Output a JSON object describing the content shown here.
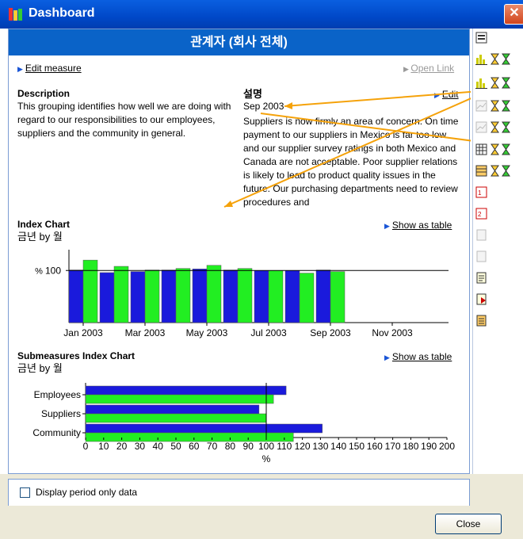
{
  "window": {
    "title": "Dashboard",
    "close_glyph": "✕"
  },
  "header": {
    "title": "관계자 (회사 전체)"
  },
  "links": {
    "edit_measure": "Edit measure",
    "open_link": "Open Link",
    "edit": "Edit",
    "show_as_table": "Show as table"
  },
  "description": {
    "label": "Description",
    "text": "This grouping identifies how well we are doing with regard to our responsibilities to our employees, suppliers and the community in general."
  },
  "korean_desc": {
    "label": "설명",
    "date": "Sep 2003",
    "text": "Suppliers is now firmly an area of concern.  On time payment to our suppliers in Mexico is far too low and our supplier survey ratings in both Mexico and Canada are not acceptable.  Poor supplier relations is likely to lead to product quality issues in the future.  Our purchasing departments need to review procedures and"
  },
  "colors": {
    "blue": "#1a1adc",
    "green": "#22ee22",
    "accent": "#0a63c8",
    "arrow": "#f5a20a"
  },
  "chart_data": [
    {
      "type": "bar",
      "title": "Index Chart",
      "subtitle": "금년 by 월",
      "ytick": "100",
      "ylabel_glyph": "%",
      "xticks": [
        "Jan 2003",
        "Mar 2003",
        "May 2003",
        "Jul 2003",
        "Sep 2003",
        "Nov 2003"
      ],
      "categories": [
        "Jan 2003",
        "Feb 2003",
        "Mar 2003",
        "Apr 2003",
        "May 2003",
        "Jun 2003",
        "Jul 2003",
        "Aug 2003",
        "Sep 2003"
      ],
      "reference": 100,
      "ylim": [
        0,
        140
      ],
      "series": [
        {
          "values": [
            101,
            96,
            98,
            101,
            103,
            101,
            100,
            100,
            101
          ],
          "color": "#1a1adc"
        },
        {
          "values": [
            120,
            108,
            101,
            104,
            110,
            104,
            100,
            95,
            98
          ],
          "color": "#22ee22"
        }
      ]
    },
    {
      "type": "bar",
      "orientation": "horizontal",
      "title": "Submeasures Index Chart",
      "subtitle": "금년 by 월",
      "categories": [
        "Employees",
        "Suppliers",
        "Community"
      ],
      "xlabel": "%",
      "xlim": [
        0,
        200
      ],
      "xticks": [
        "0",
        "10",
        "20",
        "30",
        "40",
        "50",
        "60",
        "70",
        "80",
        "90",
        "100",
        "110",
        "120",
        "130",
        "140",
        "150",
        "160",
        "170",
        "180",
        "190",
        "200"
      ],
      "reference": 100,
      "series": [
        {
          "values": [
            111,
            96,
            131
          ],
          "color": "#1a1adc"
        },
        {
          "values": [
            104,
            100,
            115
          ],
          "color": "#22ee22"
        }
      ]
    }
  ],
  "footer": {
    "checkbox_label": "Display period only data",
    "close_label": "Close"
  }
}
